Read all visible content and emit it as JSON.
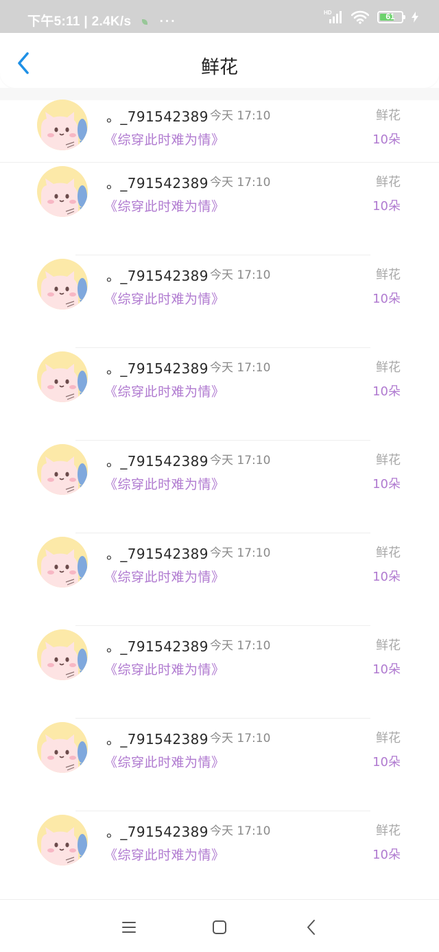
{
  "status_bar": {
    "time": "下午5:11",
    "separator": "|",
    "speed": "2.4K/s",
    "more": "···",
    "network": "HD",
    "battery": "61"
  },
  "header": {
    "title": "鲜花",
    "back_icon": "chevron-left-icon"
  },
  "records": [
    {
      "name": "。_791542389",
      "time": "今天 17:10",
      "book": "《综穿此时难为情》",
      "type": "鲜花",
      "amount": "10朵"
    },
    {
      "name": "。_791542389",
      "time": "今天 17:10",
      "book": "《综穿此时难为情》",
      "type": "鲜花",
      "amount": "10朵"
    },
    {
      "name": "。_791542389",
      "time": "今天 17:10",
      "book": "《综穿此时难为情》",
      "type": "鲜花",
      "amount": "10朵"
    },
    {
      "name": "。_791542389",
      "time": "今天 17:10",
      "book": "《综穿此时难为情》",
      "type": "鲜花",
      "amount": "10朵"
    },
    {
      "name": "。_791542389",
      "time": "今天 17:10",
      "book": "《综穿此时难为情》",
      "type": "鲜花",
      "amount": "10朵"
    },
    {
      "name": "。_791542389",
      "time": "今天 17:10",
      "book": "《综穿此时难为情》",
      "type": "鲜花",
      "amount": "10朵"
    },
    {
      "name": "。_791542389",
      "time": "今天 17:10",
      "book": "《综穿此时难为情》",
      "type": "鲜花",
      "amount": "10朵"
    },
    {
      "name": "。_791542389",
      "time": "今天 17:10",
      "book": "《综穿此时难为情》",
      "type": "鲜花",
      "amount": "10朵"
    },
    {
      "name": "。_791542389",
      "time": "今天 17:10",
      "book": "《综穿此时难为情》",
      "type": "鲜花",
      "amount": "10朵"
    }
  ],
  "colors": {
    "accent_blue": "#1e90e6",
    "book_purple": "#b07ad0",
    "status_bg": "#d2d2d2"
  },
  "system_nav": {
    "menu_icon": "menu-icon",
    "home_icon": "home-square-icon",
    "back_icon": "back-triangle-icon"
  }
}
